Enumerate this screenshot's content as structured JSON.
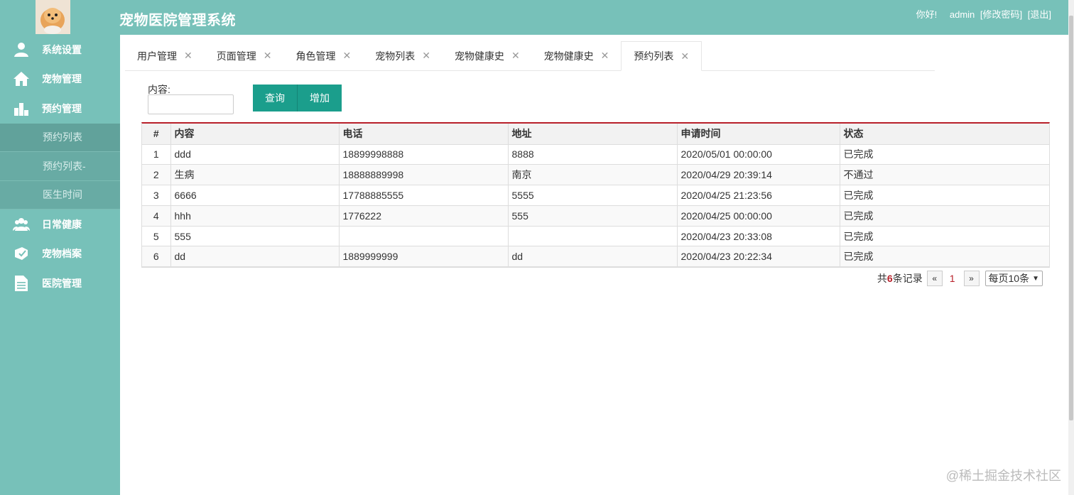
{
  "header": {
    "title": "宠物医院管理系统",
    "greeting": "你好!",
    "username": "admin",
    "change_password": "[修改密码]",
    "logout": "[退出]"
  },
  "sidebar": {
    "items": [
      {
        "label": "系统设置",
        "icon": "user-icon"
      },
      {
        "label": "宠物管理",
        "icon": "home-icon"
      },
      {
        "label": "预约管理",
        "icon": "bar-chart-icon"
      }
    ],
    "sub_items": [
      {
        "label": "预约列表"
      },
      {
        "label": "预约列表-"
      },
      {
        "label": "医生时间"
      }
    ],
    "items_after": [
      {
        "label": "日常健康",
        "icon": "group-icon"
      },
      {
        "label": "宠物档案",
        "icon": "pet-file-icon"
      },
      {
        "label": "医院管理",
        "icon": "document-icon"
      }
    ]
  },
  "tabs": [
    {
      "label": "用户管理"
    },
    {
      "label": "页面管理"
    },
    {
      "label": "角色管理"
    },
    {
      "label": "宠物列表"
    },
    {
      "label": "宠物健康史"
    },
    {
      "label": "宠物健康史"
    },
    {
      "label": "预约列表",
      "active": true
    }
  ],
  "search": {
    "label": "内容:",
    "value": "",
    "query_button": "查询",
    "add_button": "增加"
  },
  "table": {
    "headers": [
      "#",
      "内容",
      "电话",
      "地址",
      "申请时间",
      "状态"
    ],
    "rows": [
      [
        "1",
        "ddd",
        "18899998888",
        "8888",
        "2020/05/01 00:00:00",
        "已完成"
      ],
      [
        "2",
        "生病",
        "18888889998",
        "南京",
        "2020/04/29 20:39:14",
        "不通过"
      ],
      [
        "3",
        "6666",
        "17788885555",
        "5555",
        "2020/04/25 21:23:56",
        "已完成"
      ],
      [
        "4",
        "hhh",
        "1776222",
        "555",
        "2020/04/25 00:00:00",
        "已完成"
      ],
      [
        "5",
        "555",
        "",
        "",
        "2020/04/23 20:33:08",
        "已完成"
      ],
      [
        "6",
        "dd",
        "1889999999",
        "dd",
        "2020/04/23 20:22:34",
        "已完成"
      ]
    ]
  },
  "pager": {
    "total_prefix": "共",
    "total_count": "6",
    "total_suffix": "条记录",
    "prev": "«",
    "current_page": "1",
    "next": "»",
    "page_size": "每页10条"
  },
  "watermark": "@稀土掘金技术社区",
  "colors": {
    "header_bg": "#77c1b9",
    "button_bg": "#1b9e8c",
    "table_top_border": "#b8202a"
  }
}
